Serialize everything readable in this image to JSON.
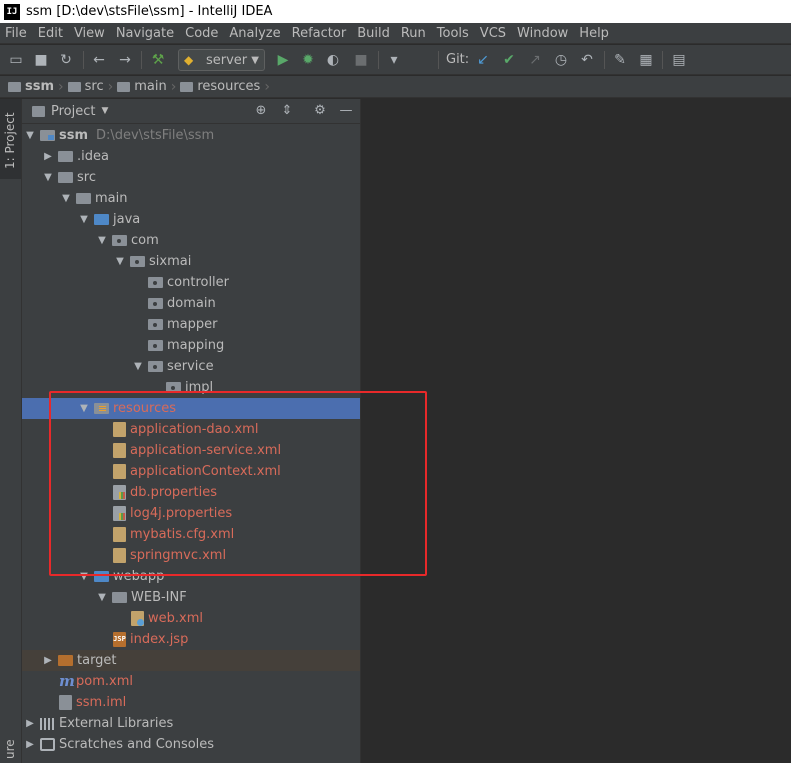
{
  "window": {
    "title": "ssm [D:\\dev\\stsFile\\ssm] - IntelliJ IDEA",
    "logo": "IJ"
  },
  "menu": [
    "File",
    "Edit",
    "View",
    "Navigate",
    "Code",
    "Analyze",
    "Refactor",
    "Build",
    "Run",
    "Tools",
    "VCS",
    "Window",
    "Help"
  ],
  "toolbar": {
    "run_config": "server",
    "git_label": "Git:",
    "icons": [
      "open-icon",
      "save-icon",
      "sync-icon",
      "back-icon",
      "forward-icon",
      "build-icon",
      "run-icon",
      "debug-icon",
      "coverage-icon",
      "stop-icon",
      "vcs-update-icon",
      "vcs-commit-icon",
      "vcs-compare-icon",
      "history-icon",
      "revert-icon",
      "settings-icon",
      "project-structure-icon",
      "sdk-icon"
    ]
  },
  "breadcrumb": [
    "ssm",
    "src",
    "main",
    "resources"
  ],
  "side_stripe": {
    "project_tab": "1: Project",
    "bottom_tab": "ure"
  },
  "project_panel": {
    "title": "Project",
    "tree": [
      {
        "label": "ssm",
        "path": "D:\\dev\\stsFile\\ssm"
      },
      {
        "label": ".idea"
      },
      {
        "label": "src"
      },
      {
        "label": "main"
      },
      {
        "label": "java"
      },
      {
        "label": "com"
      },
      {
        "label": "sixmai"
      },
      {
        "label": "controller"
      },
      {
        "label": "domain"
      },
      {
        "label": "mapper"
      },
      {
        "label": "mapping"
      },
      {
        "label": "service"
      },
      {
        "label": "impl"
      },
      {
        "label": "resources"
      },
      {
        "label": "application-dao.xml"
      },
      {
        "label": "application-service.xml"
      },
      {
        "label": "applicationContext.xml"
      },
      {
        "label": "db.properties"
      },
      {
        "label": "log4j.properties"
      },
      {
        "label": "mybatis.cfg.xml"
      },
      {
        "label": "springmvc.xml"
      },
      {
        "label": "webapp"
      },
      {
        "label": "WEB-INF"
      },
      {
        "label": "web.xml"
      },
      {
        "label": "index.jsp"
      },
      {
        "label": "target"
      },
      {
        "label": "pom.xml"
      },
      {
        "label": "ssm.iml"
      },
      {
        "label": "External Libraries"
      },
      {
        "label": "Scratches and Consoles"
      }
    ]
  },
  "colors": {
    "selection": "#4b6eaf",
    "modified_file": "#d86b5a",
    "annotation_box": "#e8292a"
  }
}
